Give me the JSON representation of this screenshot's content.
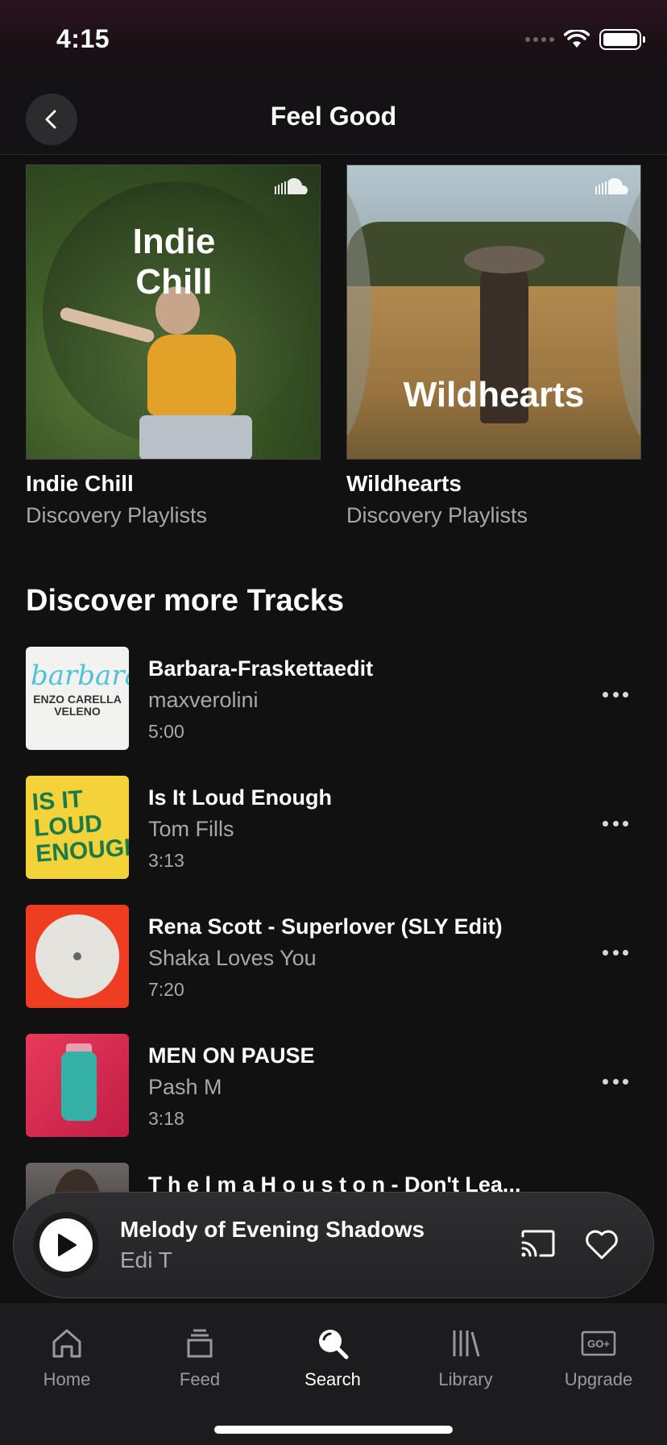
{
  "status_bar": {
    "time": "4:15"
  },
  "header": {
    "title": "Feel Good"
  },
  "playlists": [
    {
      "art_title": "Indie Chill",
      "title": "Indie Chill",
      "subtitle": "Discovery Playlists"
    },
    {
      "art_title": "Wildhearts",
      "title": "Wildhearts",
      "subtitle": "Discovery Playlists"
    }
  ],
  "section": {
    "title": "Discover more Tracks"
  },
  "tracks": [
    {
      "title": "Barbara-Fraskettaedit",
      "artist": "maxverolini",
      "duration": "5:00",
      "art_text": "barbara",
      "art_sub": "ENZO CARELLA VELENO"
    },
    {
      "title": "Is It Loud Enough",
      "artist": "Tom Fills",
      "duration": "3:13",
      "art_text": "IS IT LOUD ENOUGH"
    },
    {
      "title": "Rena Scott - Superlover (SLY Edit)",
      "artist": "Shaka Loves You",
      "duration": "7:20"
    },
    {
      "title": "MEN ON PAUSE",
      "artist": "Pash M",
      "duration": "3:18"
    },
    {
      "title": "T h e l m a H o u s t o n - Don't Lea..."
    }
  ],
  "mini_player": {
    "title": "Melody of Evening Shadows",
    "artist": "Edi T"
  },
  "tabs": [
    {
      "label": "Home",
      "icon": "home-icon"
    },
    {
      "label": "Feed",
      "icon": "feed-icon"
    },
    {
      "label": "Search",
      "icon": "search-icon",
      "active": true
    },
    {
      "label": "Library",
      "icon": "library-icon"
    },
    {
      "label": "Upgrade",
      "icon": "upgrade-icon"
    }
  ]
}
